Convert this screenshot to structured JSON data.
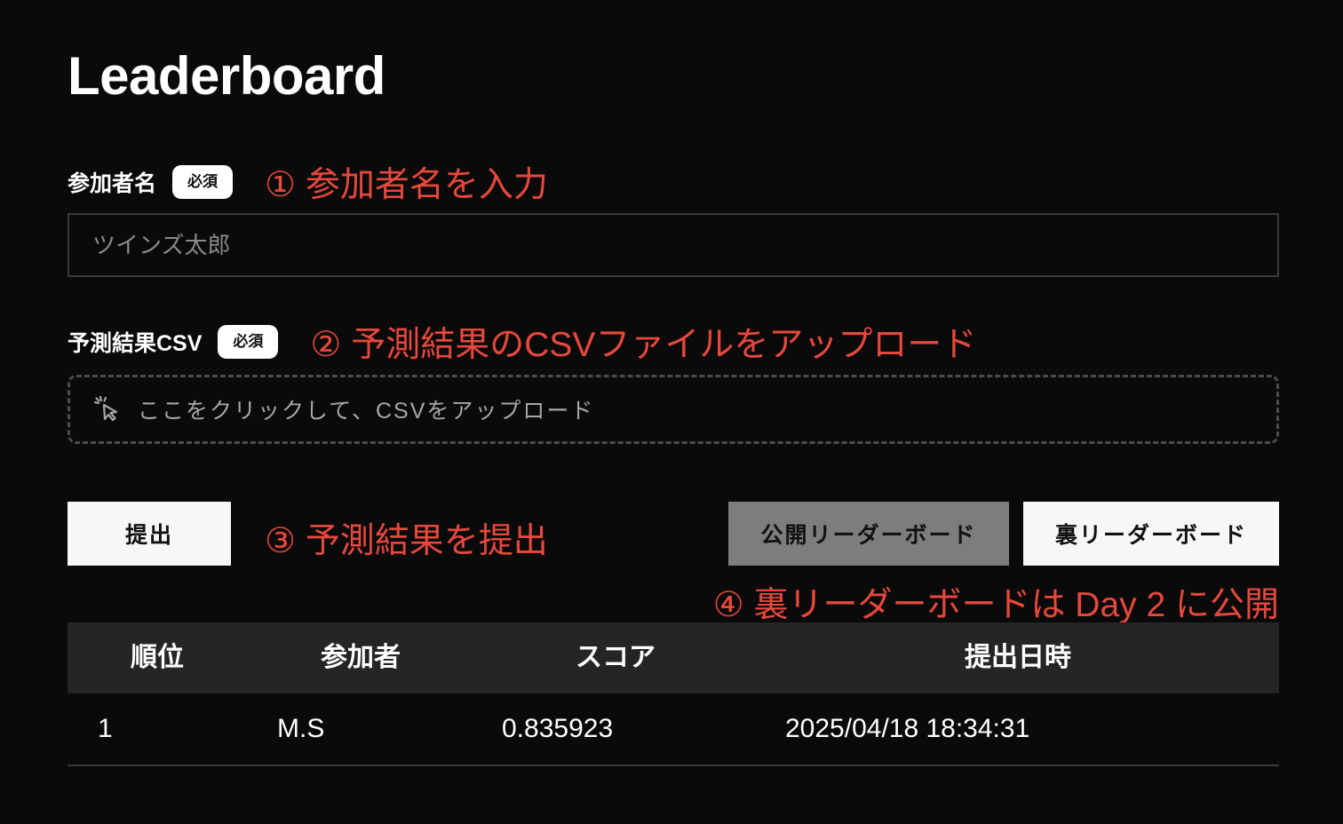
{
  "page": {
    "title": "Leaderboard"
  },
  "form": {
    "name_field": {
      "label": "参加者名",
      "badge": "必須",
      "annotation": "① 参加者名を入力",
      "placeholder": "ツインズ太郎",
      "value": ""
    },
    "csv_field": {
      "label": "予測結果CSV",
      "badge": "必須",
      "annotation": "② 予測結果のCSVファイルをアップロード",
      "upload_text": "ここをクリックして、CSVをアップロード",
      "icon": "pointer-click-icon"
    }
  },
  "actions": {
    "submit_label": "提出",
    "submit_annotation": "③ 予測結果を提出",
    "public_board_label": "公開リーダーボード",
    "hidden_board_label": "裏リーダーボード",
    "hidden_board_annotation": "④ 裏リーダーボードは Day 2 に公開"
  },
  "table": {
    "headers": [
      "順位",
      "参加者",
      "スコア",
      "提出日時"
    ],
    "rows": [
      [
        "1",
        "M.S",
        "0.835923",
        "2025/04/18 18:34:31"
      ]
    ]
  },
  "colors": {
    "background": "#0a0a0a",
    "annotation": "#e5483c",
    "table_header_bg": "#252525",
    "active_tab_bg": "#7d7d7d"
  }
}
